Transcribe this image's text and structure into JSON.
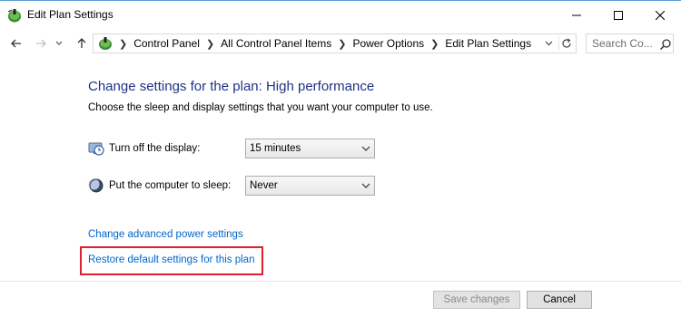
{
  "window": {
    "title": "Edit Plan Settings"
  },
  "address_bar": {
    "crumbs": [
      "Control Panel",
      "All Control Panel Items",
      "Power Options",
      "Edit Plan Settings"
    ]
  },
  "search": {
    "placeholder": "Search Co..."
  },
  "content": {
    "heading": "Change settings for the plan: High performance",
    "subtitle": "Choose the sleep and display settings that you want your computer to use.",
    "settings": [
      {
        "label": "Turn off the display:",
        "value": "15 minutes",
        "icon": "display-clock-icon"
      },
      {
        "label": "Put the computer to sleep:",
        "value": "Never",
        "icon": "moon-sleep-icon"
      }
    ],
    "links": {
      "advanced": "Change advanced power settings",
      "restore": "Restore default settings for this plan"
    }
  },
  "buttons": {
    "save": "Save changes",
    "cancel": "Cancel"
  },
  "colors": {
    "heading": "#1e3287",
    "link": "#0066cc",
    "highlight_box": "#e0202e"
  }
}
